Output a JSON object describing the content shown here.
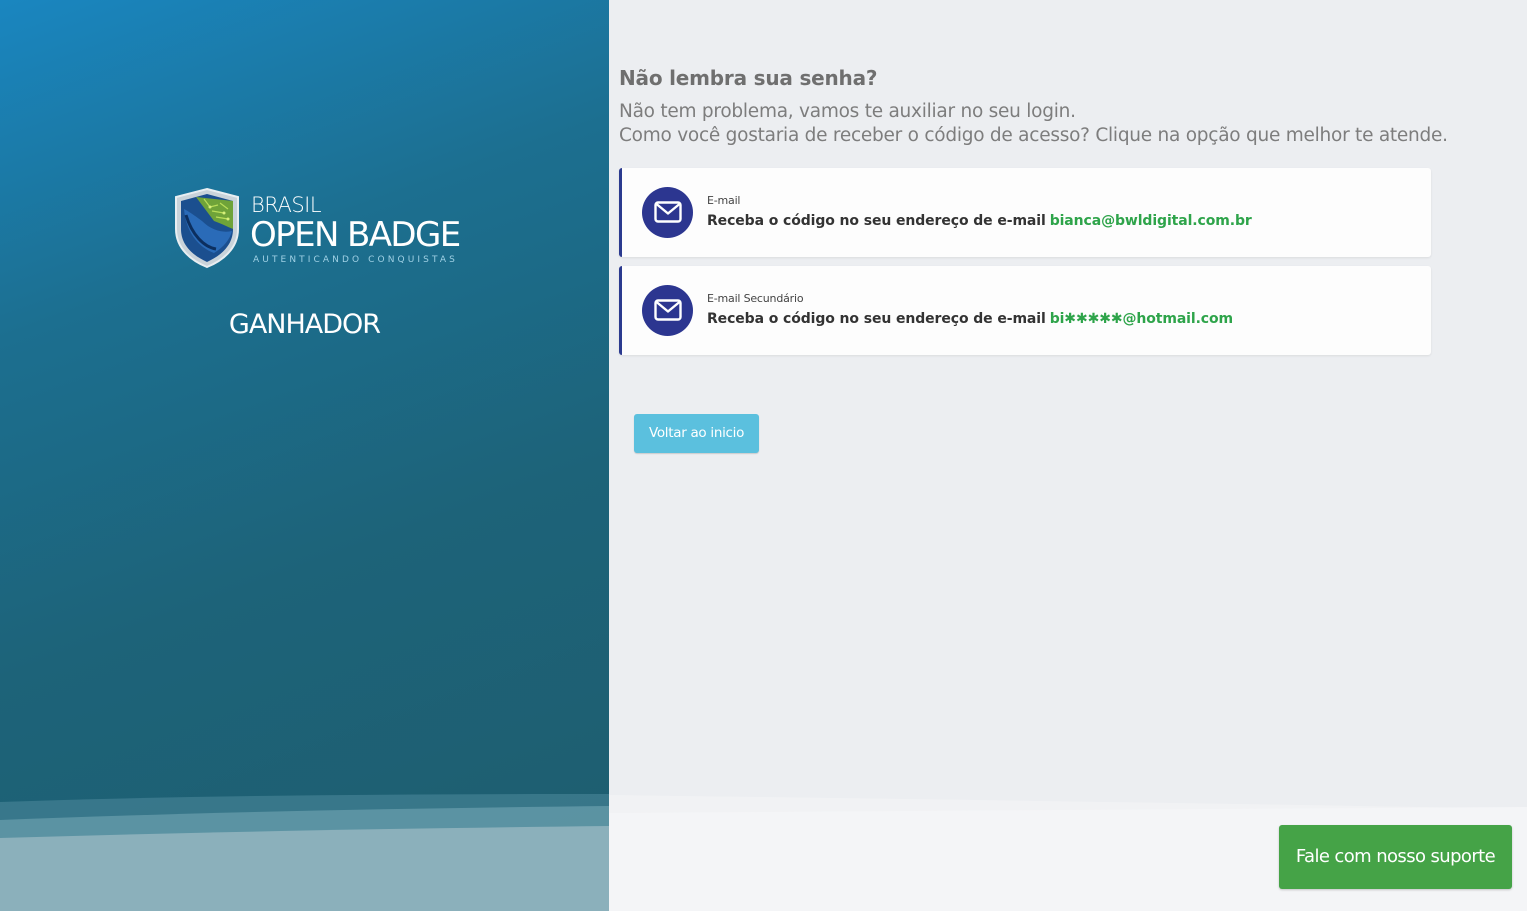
{
  "brand": {
    "logo_line1": "BRASIL",
    "logo_line2": "OPEN BADGE",
    "logo_tagline": "AUTENTICANDO CONQUISTAS",
    "role": "GANHADOR"
  },
  "main": {
    "heading": "Não lembra sua senha?",
    "intro_line1": "Não tem problema, vamos te auxiliar no seu login.",
    "intro_line2": "Como você gostaria de receber o código de acesso? Clique na opção que melhor te atende.",
    "options": [
      {
        "label": "E-mail",
        "description": "Receba o código no seu endereço de e-mail",
        "email": "bianca@bwldigital.com.br",
        "icon": "envelope-icon"
      },
      {
        "label": "E-mail Secundário",
        "description": "Receba o código no seu endereço de e-mail",
        "email": "bi✱✱✱✱✱@hotmail.com",
        "icon": "envelope-icon"
      }
    ],
    "back_button": "Voltar ao inicio"
  },
  "support_button": "Fale com nosso suporte",
  "colors": {
    "left_panel_top": "#1a86c0",
    "left_panel_bottom": "#1e5d6e",
    "card_accent": "#2b3a8f",
    "icon_circle": "#2c3690",
    "email_green": "#2ea44a",
    "back_button": "#5bc0de",
    "support_button": "#45a347"
  }
}
